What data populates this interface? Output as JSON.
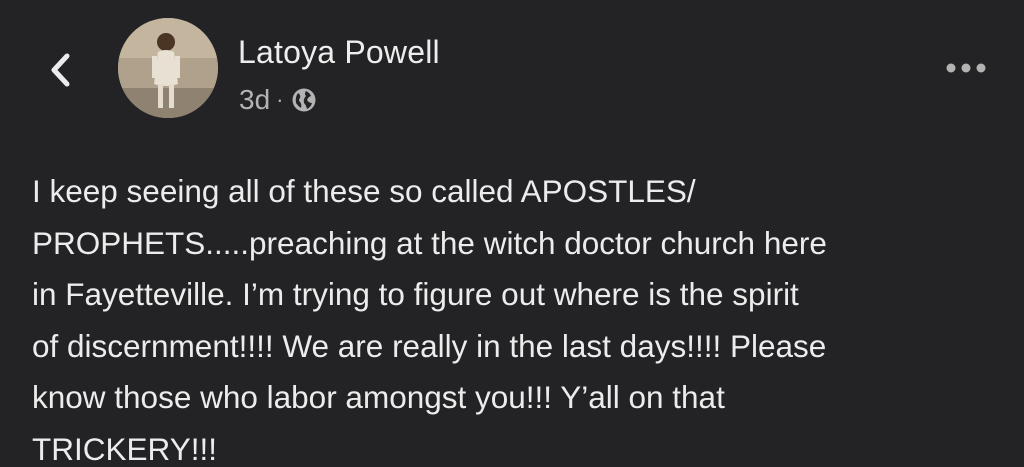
{
  "post": {
    "author_name": "Latoya Powell",
    "timestamp": "3d",
    "separator": "·",
    "privacy_icon": "globe-icon",
    "text": "I keep seeing all of these so called APOSTLES/\nPROPHETS.....preaching at the witch doctor church here\nin Fayetteville. I’m trying to figure out where is the spirit\nof discernment!!!! We are really in the last days!!!! Please\nknow those who labor amongst you!!! Y’all on that\nTRICKERY!!!"
  },
  "icons": {
    "back": "chevron-left-icon",
    "more": "more-options-icon"
  },
  "colors": {
    "background": "#232326",
    "text_primary": "#ececec",
    "text_secondary": "#b3b3b3"
  }
}
